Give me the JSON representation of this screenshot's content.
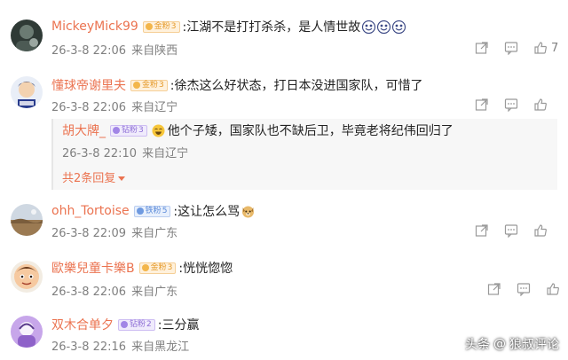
{
  "comments": [
    {
      "username": "MickeyMick99",
      "badge": {
        "type": "gold",
        "label": "金粉",
        "level": "3"
      },
      "text": ":江湖不是打打杀杀，是人情世故",
      "emojis": [
        "laugh-cry-emoji",
        "laugh-cry-emoji",
        "laugh-cry-emoji"
      ],
      "date": "26-3-8 22:06",
      "location": "来自陕西",
      "likes": "7"
    },
    {
      "username": "懂球帝谢里夫",
      "badge": {
        "type": "gold",
        "label": "金粉",
        "level": "3"
      },
      "text": ":徐杰这么好状态，打日本没进国家队，可惜了",
      "date": "26-3-8 22:06",
      "location": "来自辽宁",
      "likes": "",
      "reply": {
        "username": "胡大牌_",
        "badge": {
          "type": "purple",
          "label": "钻粉",
          "level": "3"
        },
        "text": "他个子矮，国家队也不缺后卫，毕竟老将纪伟回归了",
        "date": "26-3-8 22:10",
        "location": "来自辽宁",
        "more": "共2条回复"
      }
    },
    {
      "username": "ohh_Tortoise",
      "badge": {
        "type": "blue",
        "label": "铁粉",
        "level": "5"
      },
      "text": ":这让怎么骂",
      "emojis": [
        "dog-emoji"
      ],
      "date": "26-3-8 22:09",
      "location": "来自广东",
      "likes": ""
    },
    {
      "username": "歐樂兒童卡樂B",
      "badge": {
        "type": "gold",
        "label": "金粉",
        "level": "3"
      },
      "text": ":恍恍惚惚",
      "date": "26-3-8 22:06",
      "location": "来自广东",
      "likes": ""
    },
    {
      "username": "双木合单夕",
      "badge": {
        "type": "purple",
        "label": "钻粉",
        "level": "2"
      },
      "text": ":三分赢",
      "date": "26-3-8 22:16",
      "location": "来自黑龙江",
      "likes": ""
    }
  ],
  "watermark": {
    "brand": "头条",
    "separator": "@",
    "author": "狼叔评论"
  },
  "colors": {
    "username": "#eb7350",
    "meta": "#808080",
    "text": "#222222"
  }
}
